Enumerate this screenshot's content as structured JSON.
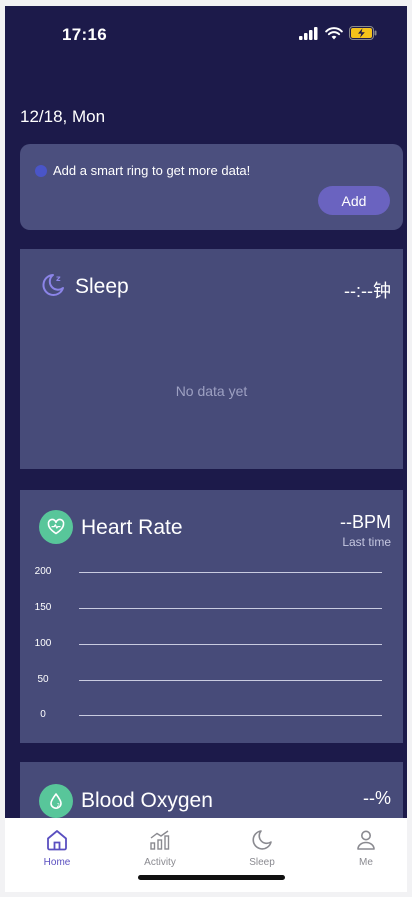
{
  "status": {
    "time": "17:16"
  },
  "header": {
    "date": "12/18, Mon"
  },
  "ring_prompt": {
    "message": "Add a smart ring to get more data!",
    "add_label": "Add"
  },
  "sleep": {
    "title": "Sleep",
    "value": "--:--钟",
    "empty": "No data yet"
  },
  "heart_rate": {
    "title": "Heart Rate",
    "value": "--BPM",
    "sub": "Last time",
    "y_ticks": [
      "200",
      "150",
      "100",
      "50",
      "0"
    ]
  },
  "blood_oxygen": {
    "title": "Blood Oxygen",
    "value": "--%"
  },
  "tabs": [
    {
      "label": "Home",
      "icon": "home-icon",
      "active": true
    },
    {
      "label": "Activity",
      "icon": "activity-chart-icon",
      "active": false
    },
    {
      "label": "Sleep",
      "icon": "moon-icon",
      "active": false
    },
    {
      "label": "Me",
      "icon": "person-icon",
      "active": false
    }
  ],
  "colors": {
    "background": "#1c1a4a",
    "card": "#474b79",
    "accent": "#6a63c0",
    "green": "#58c69a",
    "tab_active": "#5a4fc0"
  }
}
